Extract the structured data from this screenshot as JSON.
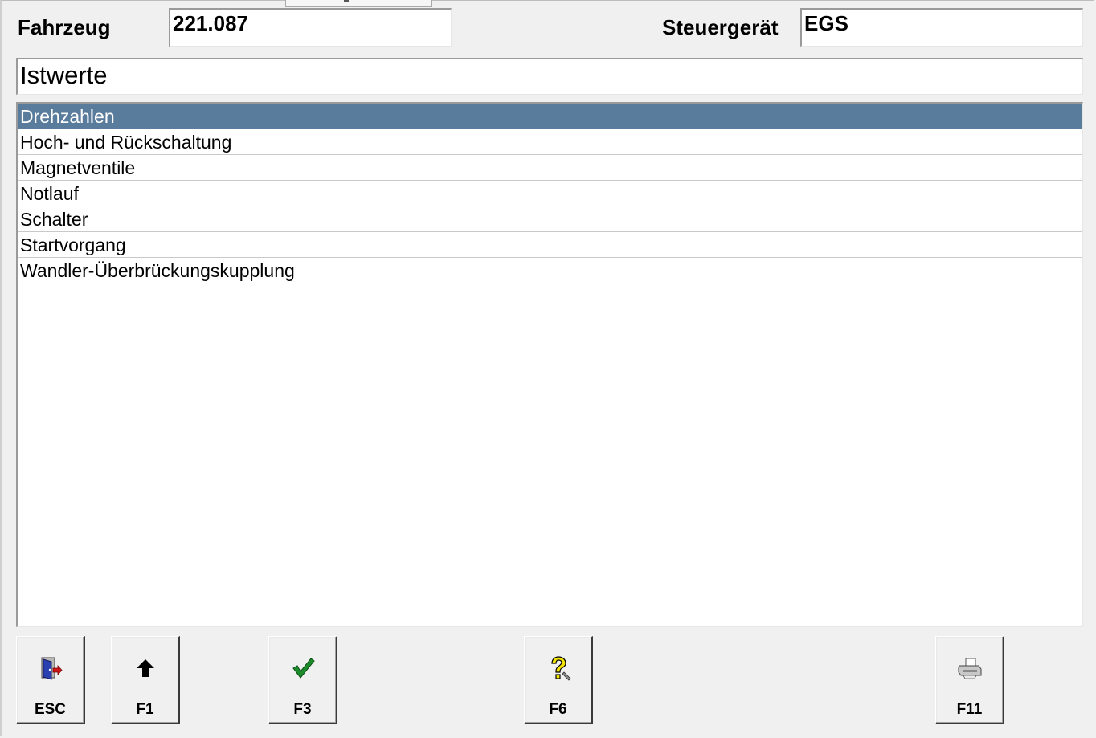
{
  "header": {
    "vehicle_label": "Fahrzeug",
    "vehicle_value": "221.087",
    "ecu_label": "Steuergerät",
    "ecu_value": "EGS"
  },
  "section": {
    "title": "Istwerte"
  },
  "list": {
    "selected_index": 0,
    "items": [
      {
        "label": "Drehzahlen"
      },
      {
        "label": "Hoch- und Rückschaltung"
      },
      {
        "label": "Magnetventile"
      },
      {
        "label": "Notlauf"
      },
      {
        "label": "Schalter"
      },
      {
        "label": "Startvorgang"
      },
      {
        "label": "Wandler-Überbrückungskupplung"
      }
    ]
  },
  "toolbar": {
    "buttons": [
      {
        "key": "ESC",
        "icon": "exit-door-icon"
      },
      {
        "key": "F1",
        "icon": "arrow-up-icon"
      },
      {
        "key": "F3",
        "icon": "checkmark-icon"
      },
      {
        "key": "F6",
        "icon": "help-question-icon"
      },
      {
        "key": "F11",
        "icon": "printer-icon"
      }
    ]
  },
  "colors": {
    "selection": "#5a7c9c",
    "checkmark": "#1c8c2a",
    "help": "#f2e200"
  }
}
